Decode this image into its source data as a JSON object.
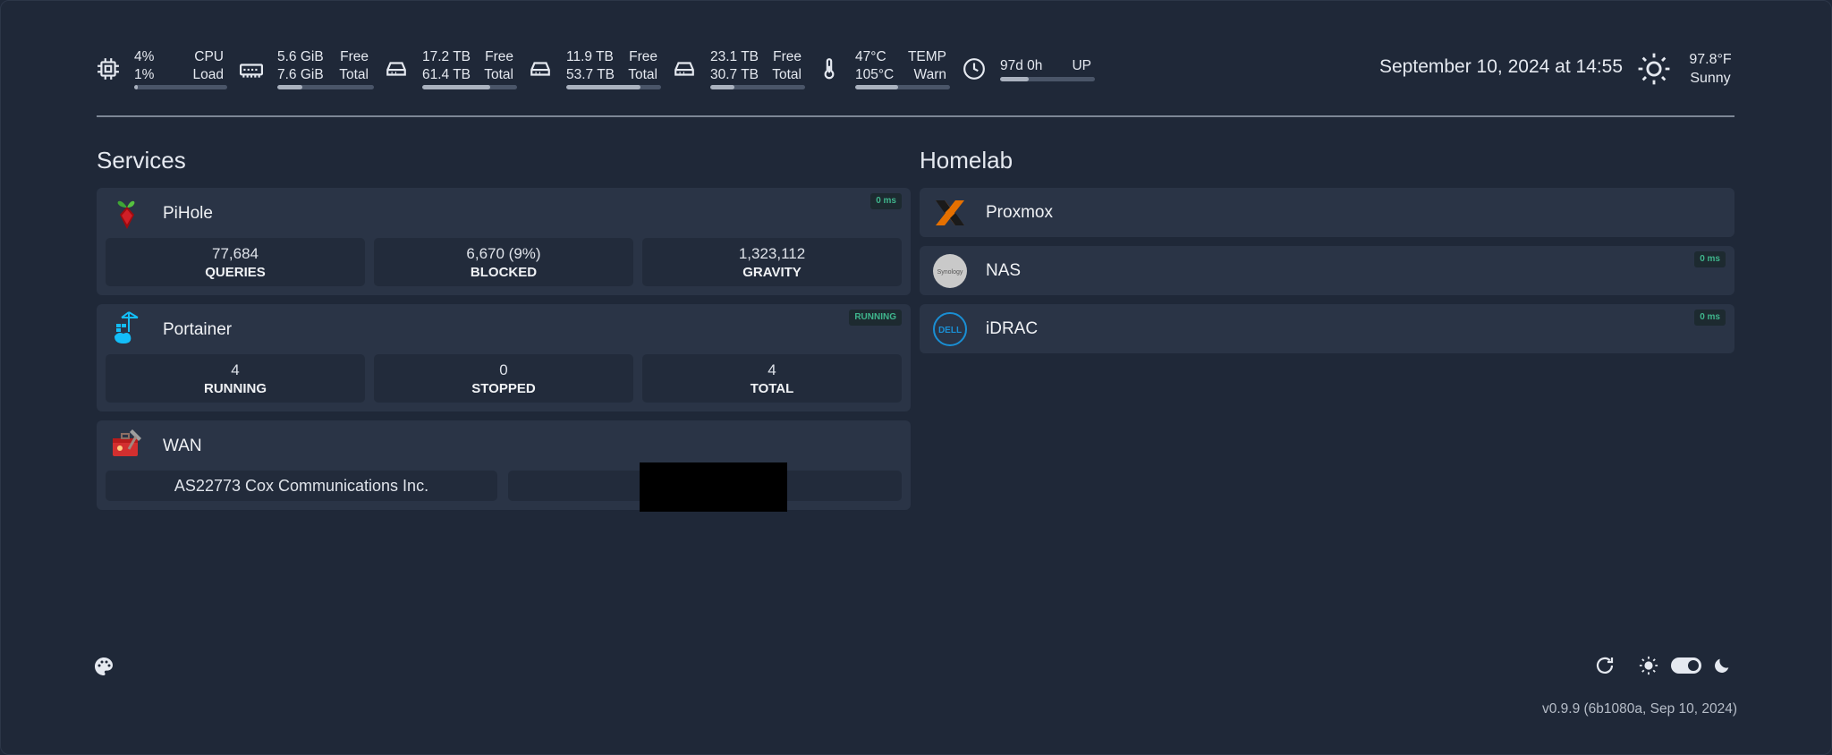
{
  "topbar": {
    "cpu": {
      "icon": "cpu-icon",
      "v1": "4%",
      "v2": "1%",
      "l1": "CPU",
      "l2": "Load",
      "fill": 0.04
    },
    "memory": {
      "icon": "memory-icon",
      "v1": "5.6 GiB",
      "v2": "7.6 GiB",
      "l1": "Free",
      "l2": "Total",
      "fill": 0.26
    },
    "disk1": {
      "icon": "hard-drive-icon",
      "v1": "17.2 TB",
      "v2": "61.4 TB",
      "l1": "Free",
      "l2": "Total",
      "fill": 0.72
    },
    "disk2": {
      "icon": "hard-drive-icon",
      "v1": "11.9 TB",
      "v2": "53.7 TB",
      "l1": "Free",
      "l2": "Total",
      "fill": 0.78
    },
    "disk3": {
      "icon": "hard-drive-icon",
      "v1": "23.1 TB",
      "v2": "30.7 TB",
      "l1": "Free",
      "l2": "Total",
      "fill": 0.25
    },
    "temp": {
      "icon": "thermometer-icon",
      "v1": "47°C",
      "v2": "105°C",
      "l1": "TEMP",
      "l2": "Warn",
      "fill": 0.45
    },
    "uptime": {
      "icon": "clock-icon",
      "v1": "97d 0h",
      "l1": "UP",
      "fill": 0.3
    },
    "datetime": "September 10, 2024 at 14:55",
    "weather": {
      "icon": "sun-icon",
      "temp": "97.8°F",
      "condition": "Sunny"
    }
  },
  "services": {
    "title": "Services",
    "pihole": {
      "name": "PiHole",
      "badge": "0 ms",
      "stats": [
        {
          "value": "77,684",
          "label": "QUERIES"
        },
        {
          "value": "6,670 (9%)",
          "label": "BLOCKED"
        },
        {
          "value": "1,323,112",
          "label": "GRAVITY"
        }
      ]
    },
    "portainer": {
      "name": "Portainer",
      "badge": "RUNNING",
      "stats": [
        {
          "value": "4",
          "label": "RUNNING"
        },
        {
          "value": "0",
          "label": "STOPPED"
        },
        {
          "value": "4",
          "label": "TOTAL"
        }
      ]
    },
    "wan": {
      "name": "WAN",
      "isp": "AS22773 Cox Communications Inc."
    }
  },
  "homelab": {
    "title": "Homelab",
    "items": [
      {
        "name": "Proxmox",
        "badge": ""
      },
      {
        "name": "NAS",
        "badge": "0 ms",
        "logo_text": "Synology"
      },
      {
        "name": "iDRAC",
        "badge": "0 ms",
        "logo_text": "DELL"
      }
    ]
  },
  "footer": {
    "version": "v0.9.9 (6b1080a, Sep 10, 2024)"
  },
  "colors": {
    "background": "#1f2838",
    "card": "#2a3446",
    "badge_text": "#3fb58c"
  }
}
